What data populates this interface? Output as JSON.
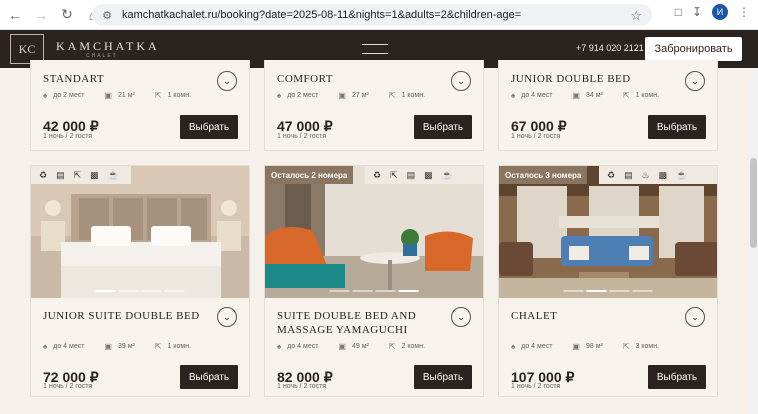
{
  "browser": {
    "url": "kamchatkachalet.ru/booking?date=2025-08-11&nights=1&adults=2&children-age=",
    "avatar_letter": "И"
  },
  "header": {
    "logo_mark": "KC",
    "logo_text": "KAMCHATKA",
    "logo_sub": "CHALET",
    "phone": "+7 914 020 2121",
    "book_button": "Забронировать"
  },
  "rooms_top": [
    {
      "title": "STANDART",
      "guests": "до 2 мест",
      "area": "21 м²",
      "rooms": "1 комн.",
      "price": "42 000 ₽",
      "price_note": "1 ночь / 2 гостя",
      "button": "Выбрать"
    },
    {
      "title": "COMFORT",
      "guests": "до 2 мест",
      "area": "27 м²",
      "rooms": "1 комн.",
      "price": "47 000 ₽",
      "price_note": "1 ночь / 2 гостя",
      "button": "Выбрать"
    },
    {
      "title": "JUNIOR DOUBLE BED",
      "guests": "до 4 мест",
      "area": "34 м²",
      "rooms": "1 комн.",
      "price": "67 000 ₽",
      "price_note": "1 ночь / 2 гостя",
      "button": "Выбрать"
    }
  ],
  "rooms_bottom": [
    {
      "badge": "",
      "title_line1": "JUNIOR SUITE DOUBLE BED",
      "title_line2": "",
      "guests": "до 4 мест",
      "area": "39 м²",
      "rooms": "1 комн.",
      "price": "72 000 ₽",
      "price_note": "1 ночь / 2 гостя",
      "button": "Выбрать"
    },
    {
      "badge": "Осталось 2 номера",
      "title_line1": "SUITE DOUBLE BED AND",
      "title_line2": "MASSAGE YAMAGUCHI",
      "guests": "до 4 мест",
      "area": "49 м²",
      "rooms": "2 комн.",
      "price": "82 000 ₽",
      "price_note": "1 ночь / 2 гостя",
      "button": "Выбрать"
    },
    {
      "badge": "Осталось 3 номера",
      "title_line1": "CHALET",
      "title_line2": "",
      "guests": "до 4 мест",
      "area": "98 м²",
      "rooms": "3 комн.",
      "price": "107 000 ₽",
      "price_note": "1 ночь / 2 гостя",
      "button": "Выбрать"
    }
  ],
  "colors": {
    "dark": "#2a2320",
    "badge": "#8a7561",
    "card": "#f7f2ec"
  }
}
